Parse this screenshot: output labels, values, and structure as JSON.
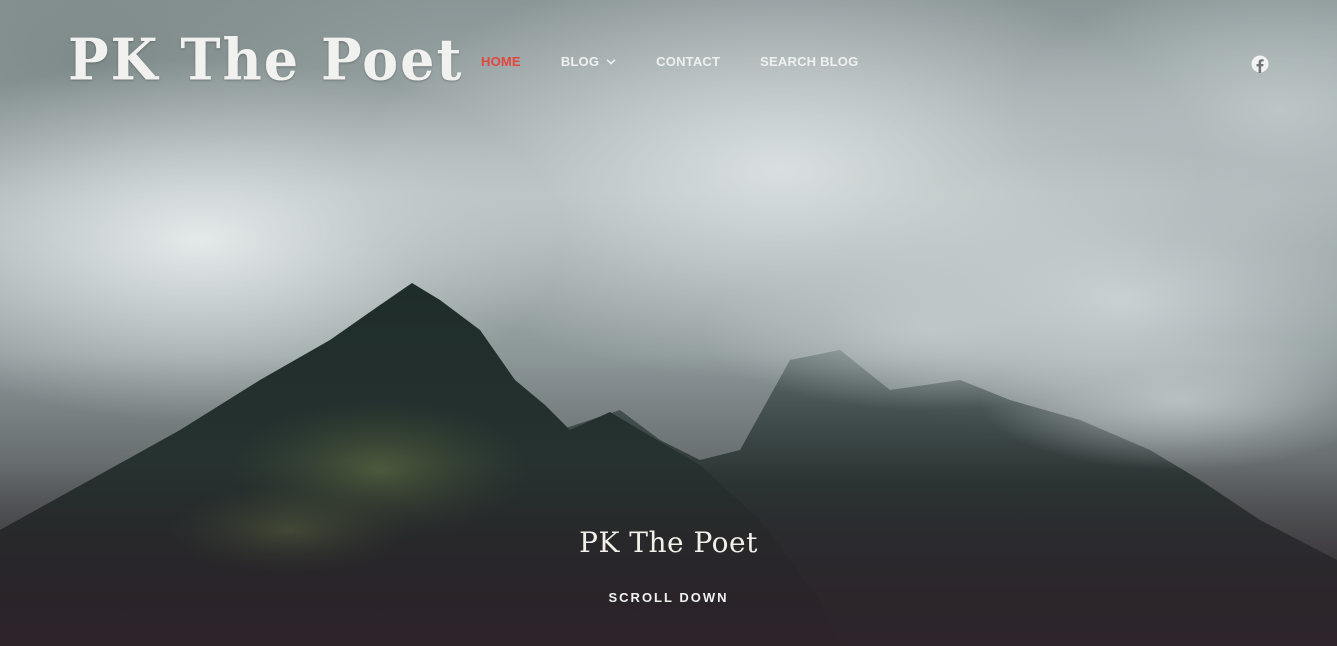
{
  "site": {
    "logo_text": "PK The Poet"
  },
  "nav": {
    "items": [
      {
        "label": "HOME",
        "active": true
      },
      {
        "label": "BLOG",
        "has_dropdown": true
      },
      {
        "label": "CONTACT"
      },
      {
        "label": "SEARCH BLOG"
      }
    ]
  },
  "social": {
    "icon": "facebook-icon"
  },
  "hero": {
    "title": "PK The Poet",
    "scroll_label": "SCROLL DOWN"
  },
  "colors": {
    "accent_active": "#e3453f",
    "nav_text": "#eef0f0",
    "title_text": "#f3efe9"
  }
}
